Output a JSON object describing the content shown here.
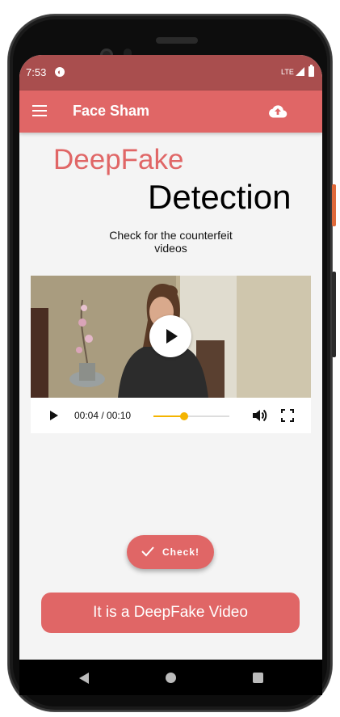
{
  "status_bar": {
    "time": "7:53",
    "network": "LTE"
  },
  "app_bar": {
    "title": "Face Sham"
  },
  "hero": {
    "title_part1": "DeepFake",
    "title_part2": "Detection",
    "subtitle": "Check for the counterfeit videos"
  },
  "video_player": {
    "current_time": "00:04",
    "duration": "00:10",
    "time_display": "00:04 / 00:10",
    "progress": 0.4
  },
  "actions": {
    "check_label": "Check!",
    "result_label": "It is a DeepFake Video"
  },
  "colors": {
    "primary": "#e06666",
    "status_bar": "#a94e4e",
    "accent": "#f4b400"
  },
  "icons": [
    "menu-icon",
    "cloud-upload-icon",
    "play-icon",
    "volume-icon",
    "fullscreen-icon",
    "check-icon",
    "back-icon",
    "home-icon",
    "recents-icon"
  ]
}
